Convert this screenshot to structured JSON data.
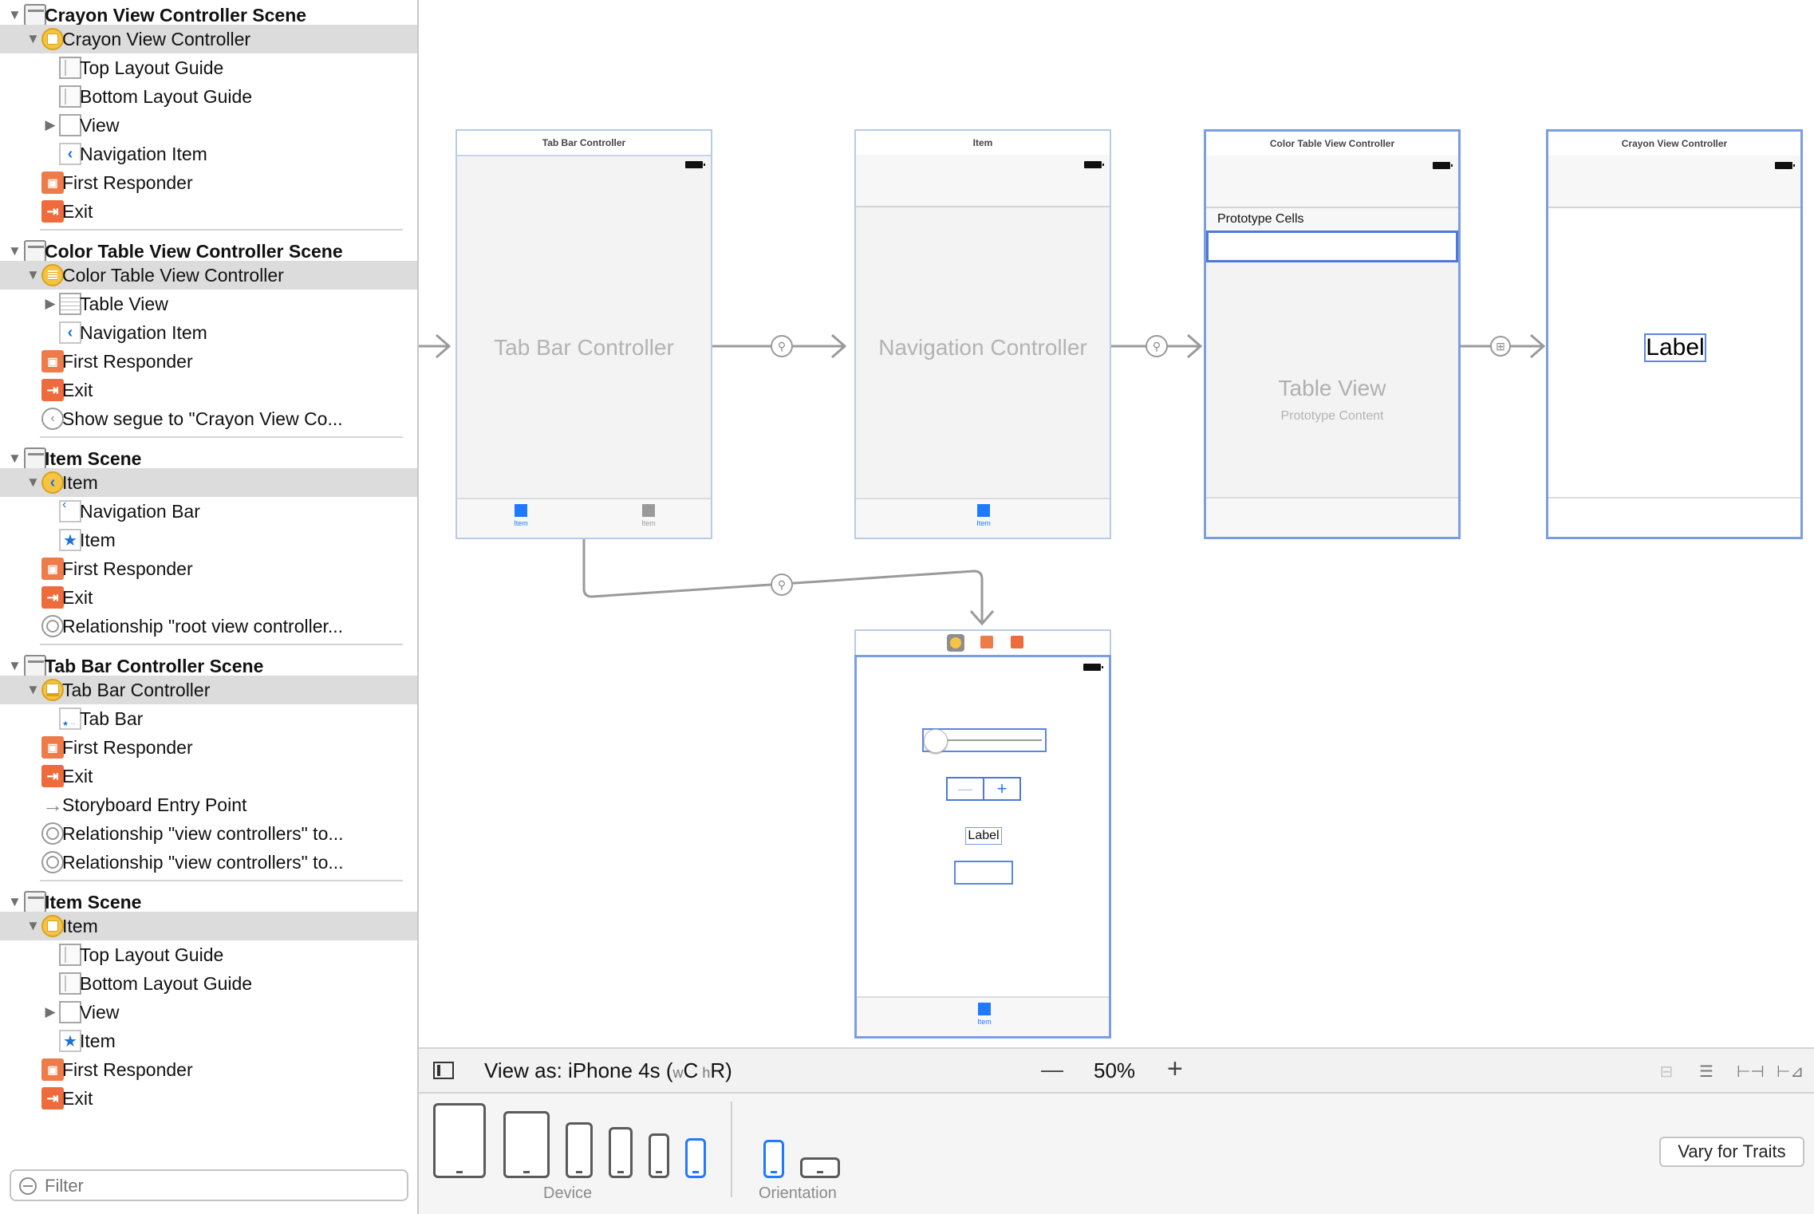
{
  "outline": {
    "rows": [
      {
        "kind": "scene",
        "label": "Crayon View Controller Scene",
        "icon": "scene-icon"
      },
      {
        "kind": "vc",
        "label": "Crayon View Controller",
        "icon": "view-controller-icon",
        "selected": true
      },
      {
        "kind": "child",
        "label": "Top Layout Guide",
        "icon": "layout-guide-icon"
      },
      {
        "kind": "child",
        "label": "Bottom Layout Guide",
        "icon": "layout-guide-icon"
      },
      {
        "kind": "child",
        "label": "View",
        "icon": "view-icon",
        "expandable": true
      },
      {
        "kind": "child",
        "label": "Navigation Item",
        "icon": "navigation-item-icon"
      },
      {
        "kind": "vcchild",
        "label": "First Responder",
        "icon": "first-responder-icon"
      },
      {
        "kind": "vcchild",
        "label": "Exit",
        "icon": "exit-icon"
      },
      {
        "kind": "scene",
        "label": "Color Table View Controller Scene",
        "icon": "scene-icon"
      },
      {
        "kind": "vc",
        "label": "Color Table View Controller",
        "icon": "table-view-controller-icon",
        "selected": true
      },
      {
        "kind": "child",
        "label": "Table View",
        "icon": "table-view-icon",
        "expandable": true
      },
      {
        "kind": "child",
        "label": "Navigation Item",
        "icon": "navigation-item-icon"
      },
      {
        "kind": "vcchild",
        "label": "First Responder",
        "icon": "first-responder-icon"
      },
      {
        "kind": "vcchild",
        "label": "Exit",
        "icon": "exit-icon"
      },
      {
        "kind": "vcchild",
        "label": "Show segue to \"Crayon View Co...",
        "icon": "segue-icon"
      },
      {
        "kind": "scene",
        "label": "Item Scene",
        "icon": "scene-icon"
      },
      {
        "kind": "vc",
        "label": "Item",
        "icon": "navigation-controller-icon",
        "selected": true
      },
      {
        "kind": "child",
        "label": "Navigation Bar",
        "icon": "navigation-bar-icon"
      },
      {
        "kind": "child",
        "label": "Item",
        "icon": "tab-bar-item-icon"
      },
      {
        "kind": "vcchild",
        "label": "First Responder",
        "icon": "first-responder-icon"
      },
      {
        "kind": "vcchild",
        "label": "Exit",
        "icon": "exit-icon"
      },
      {
        "kind": "vcchild",
        "label": "Relationship \"root view controller...",
        "icon": "relationship-icon"
      },
      {
        "kind": "scene",
        "label": "Tab Bar Controller Scene",
        "icon": "scene-icon"
      },
      {
        "kind": "vc",
        "label": "Tab Bar Controller",
        "icon": "tab-bar-controller-icon",
        "selected": true
      },
      {
        "kind": "child",
        "label": "Tab Bar",
        "icon": "tab-bar-icon"
      },
      {
        "kind": "vcchild",
        "label": "First Responder",
        "icon": "first-responder-icon"
      },
      {
        "kind": "vcchild",
        "label": "Exit",
        "icon": "exit-icon"
      },
      {
        "kind": "vcchild",
        "label": "Storyboard Entry Point",
        "icon": "entry-point-arrow-icon"
      },
      {
        "kind": "vcchild",
        "label": "Relationship \"view controllers\" to...",
        "icon": "relationship-icon"
      },
      {
        "kind": "vcchild",
        "label": "Relationship \"view controllers\" to...",
        "icon": "relationship-icon"
      },
      {
        "kind": "scene",
        "label": "Item Scene",
        "icon": "scene-icon"
      },
      {
        "kind": "vc",
        "label": "Item",
        "icon": "view-controller-icon",
        "selected": true
      },
      {
        "kind": "child",
        "label": "Top Layout Guide",
        "icon": "layout-guide-icon"
      },
      {
        "kind": "child",
        "label": "Bottom Layout Guide",
        "icon": "layout-guide-icon"
      },
      {
        "kind": "child",
        "label": "View",
        "icon": "view-icon",
        "expandable": true
      },
      {
        "kind": "child",
        "label": "Item",
        "icon": "tab-bar-item-icon"
      },
      {
        "kind": "vcchild",
        "label": "First Responder",
        "icon": "first-responder-icon"
      },
      {
        "kind": "vcchild",
        "label": "Exit",
        "icon": "exit-icon"
      }
    ],
    "filter_placeholder": "Filter"
  },
  "canvas": {
    "tab_bar_controller": {
      "title": "Tab Bar Controller",
      "body_label": "Tab Bar Controller",
      "tabs": [
        "Item",
        "Item"
      ]
    },
    "navigation_controller": {
      "title": "Item",
      "body_label": "Navigation Controller",
      "tabs": [
        "Item"
      ]
    },
    "color_table_vc": {
      "title": "Color Table View Controller",
      "section_header": "Prototype Cells",
      "body_label": "Table View",
      "body_sublabel": "Prototype Content"
    },
    "crayon_vc": {
      "title": "Crayon View Controller",
      "label": "Label"
    },
    "item_vc": {
      "label": "Label",
      "stepper_minus": "—",
      "stepper_plus": "+",
      "tabs": [
        "Item"
      ]
    }
  },
  "viewas": {
    "prefix": "View as: iPhone 4s (",
    "w": "w",
    "w_val": "C",
    "h": "h",
    "h_val": "R",
    "suffix": ")",
    "zoom_minus": "—",
    "zoom": "50%",
    "zoom_plus": "+"
  },
  "devicebar": {
    "device_caption": "Device",
    "orientation_caption": "Orientation",
    "vary_button": "Vary for Traits"
  },
  "colors": {
    "accent": "#1f7aff",
    "selection_row": "#dcdcdc",
    "vc_icon": "#f6c344",
    "exit_icon": "#ee6b3c"
  }
}
